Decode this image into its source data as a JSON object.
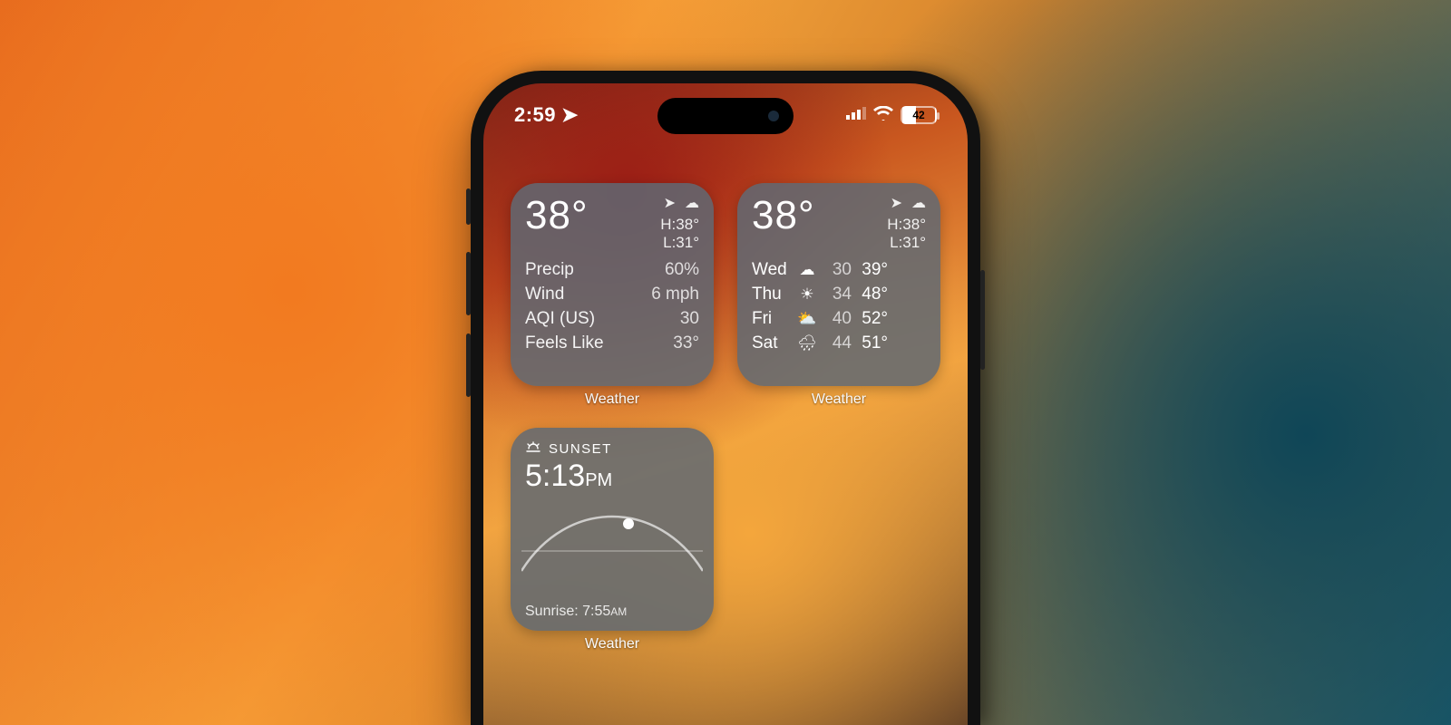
{
  "status": {
    "time": "2:59",
    "location_arrow": "➤",
    "battery_pct": "42"
  },
  "widgets": {
    "label": "Weather",
    "details": {
      "temp": "38°",
      "high": "H:38°",
      "low": "L:31°",
      "rows": [
        {
          "k": "Precip",
          "v": "60%"
        },
        {
          "k": "Wind",
          "v": "6 mph"
        },
        {
          "k": "AQI (US)",
          "v": "30"
        },
        {
          "k": "Feels Like",
          "v": "33°"
        }
      ]
    },
    "forecast": {
      "temp": "38°",
      "high": "H:38°",
      "low": "L:31°",
      "days": [
        {
          "d": "Wed",
          "icon": "☁",
          "lo": "30",
          "hi": "39°"
        },
        {
          "d": "Thu",
          "icon": "☀",
          "lo": "34",
          "hi": "48°"
        },
        {
          "d": "Fri",
          "icon": "⛅",
          "lo": "40",
          "hi": "52°"
        },
        {
          "d": "Sat",
          "icon": "🌧",
          "lo": "44",
          "hi": "51°"
        }
      ]
    },
    "sun": {
      "title": "SUNSET",
      "time": "5:13",
      "ampm": "PM",
      "sunrise_label": "Sunrise: 7:55",
      "sunrise_ampm": "AM"
    }
  }
}
